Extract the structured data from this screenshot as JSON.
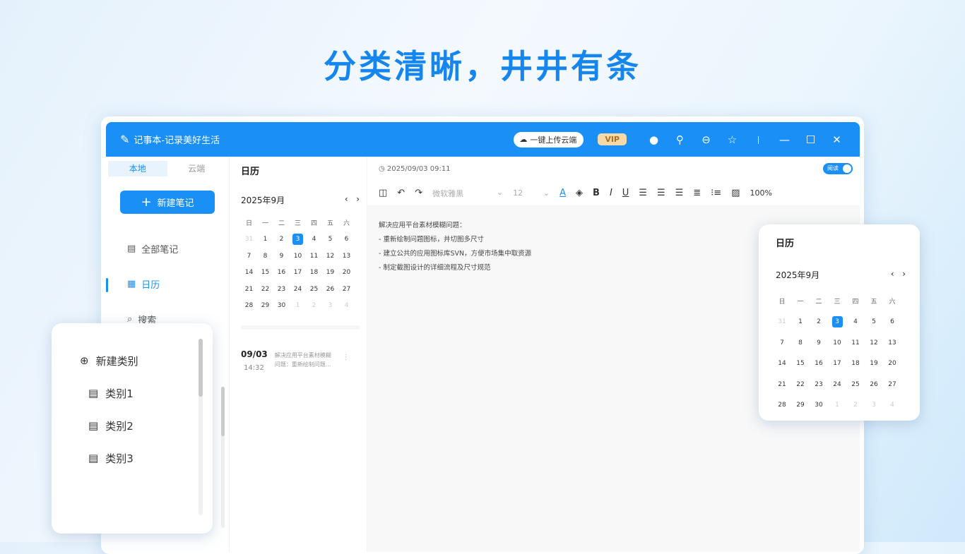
{
  "hero": "分类清晰，井井有条",
  "app": {
    "title": "记事本-记录美好生活",
    "upload": "一键上传云端",
    "vip": "VIP"
  },
  "sidebar": {
    "tabs": [
      "本地",
      "云端"
    ],
    "new_note": "新建笔记",
    "items": [
      "全部笔记",
      "日历",
      "搜索"
    ]
  },
  "list": {
    "heading": "日历",
    "month": "2025年9月",
    "weekdays": [
      "日",
      "一",
      "二",
      "三",
      "四",
      "五",
      "六"
    ],
    "notes": [
      {
        "date": "09/03",
        "time": "14:32",
        "preview": "解决应用平台素材模糊问题：重新绘制问题..."
      }
    ]
  },
  "editor": {
    "datetime": "2025/09/03 09:11",
    "toggle": "阅读",
    "font": "微软雅黑",
    "size": "12",
    "zoom": "100%",
    "lines": [
      "解决应用平台素材模糊问题：",
      "- 重新绘制问题图标，并切图多尺寸",
      "- 建立公共的应用图标库SVN，方便市场集中取资源",
      "- 制定截图设计的详细流程及尺寸规范"
    ]
  },
  "category": {
    "new": "新建类别",
    "items": [
      "类别1",
      "类别2",
      "类别3"
    ]
  },
  "calendar_popup": {
    "heading": "日历",
    "month": "2025年9月"
  },
  "days": [
    {
      "d": "31",
      "o": true
    },
    {
      "d": "1"
    },
    {
      "d": "2"
    },
    {
      "d": "3",
      "s": true
    },
    {
      "d": "4"
    },
    {
      "d": "5"
    },
    {
      "d": "6"
    },
    {
      "d": "7"
    },
    {
      "d": "8"
    },
    {
      "d": "9"
    },
    {
      "d": "10"
    },
    {
      "d": "11"
    },
    {
      "d": "12"
    },
    {
      "d": "13"
    },
    {
      "d": "14"
    },
    {
      "d": "15"
    },
    {
      "d": "16"
    },
    {
      "d": "17"
    },
    {
      "d": "18"
    },
    {
      "d": "19"
    },
    {
      "d": "20"
    },
    {
      "d": "21"
    },
    {
      "d": "22"
    },
    {
      "d": "23"
    },
    {
      "d": "24"
    },
    {
      "d": "25"
    },
    {
      "d": "26"
    },
    {
      "d": "27"
    },
    {
      "d": "28"
    },
    {
      "d": "29"
    },
    {
      "d": "30"
    },
    {
      "d": "1",
      "o": true
    },
    {
      "d": "2",
      "o": true
    },
    {
      "d": "3",
      "o": true
    },
    {
      "d": "4",
      "o": true
    }
  ],
  "colors": {
    "accent": "#1a8ff5",
    "hero": "#1586ee"
  }
}
